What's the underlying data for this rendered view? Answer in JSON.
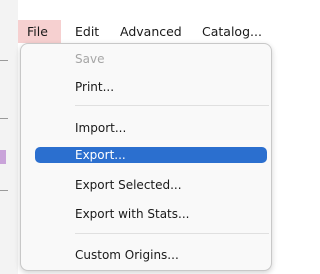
{
  "menubar": {
    "items": [
      {
        "label": "File",
        "active": true
      },
      {
        "label": "Edit"
      },
      {
        "label": "Advanced"
      },
      {
        "label": "Catalog..."
      }
    ]
  },
  "file_menu": {
    "items": [
      {
        "label": "Save",
        "state": "disabled"
      },
      {
        "label": "Print..."
      },
      {
        "label": "Import..."
      },
      {
        "label": "Export...",
        "state": "selected"
      },
      {
        "label": "Export Selected..."
      },
      {
        "label": "Export with Stats..."
      },
      {
        "label": "Custom Origins..."
      }
    ]
  },
  "colors": {
    "selection": "#2b6fcf",
    "active_menubar": "#f6d0d0"
  }
}
